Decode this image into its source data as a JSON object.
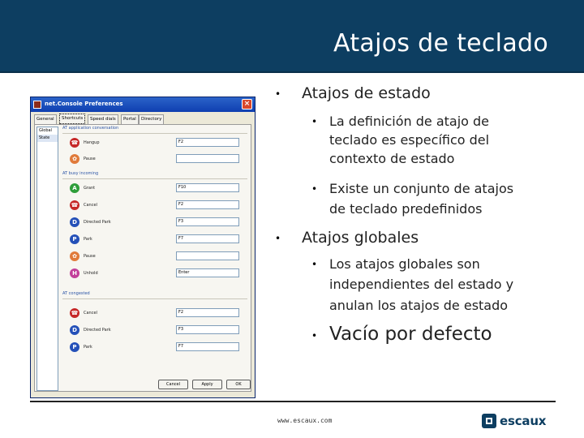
{
  "slide": {
    "title": "Atajos de teclado"
  },
  "screenshot": {
    "window_title": "net.Console Preferences",
    "close_glyph": "×",
    "tabs": [
      "General",
      "Shortcuts",
      "Speed dials",
      "Portal",
      "Directory"
    ],
    "active_tab": "Shortcuts",
    "side_list": [
      "Global",
      "State"
    ],
    "groups": [
      {
        "label": "AT application conversation"
      },
      {
        "label": "AT busy incoming"
      },
      {
        "label": "AT congested"
      }
    ],
    "rows": [
      {
        "label": "Hangup",
        "key": "F2",
        "color": "#c62828",
        "glyph": "☎",
        "icon": "hangup-icon"
      },
      {
        "label": "Pause",
        "key": "",
        "color": "#e07a3a",
        "glyph": "✿",
        "icon": "pause-icon"
      },
      {
        "label": "Grant",
        "key": "F10",
        "color": "#2e9e3a",
        "glyph": "A",
        "icon": "accept-icon"
      },
      {
        "label": "Cancel",
        "key": "F2",
        "color": "#c62828",
        "glyph": "☎",
        "icon": "cancel-icon"
      },
      {
        "label": "Directed Park",
        "key": "F3",
        "color": "#2450b8",
        "glyph": "D",
        "icon": "directed-park-icon"
      },
      {
        "label": "Park",
        "key": "F7",
        "color": "#2450b8",
        "glyph": "P",
        "icon": "park-icon"
      },
      {
        "label": "Pause",
        "key": "",
        "color": "#e07a3a",
        "glyph": "✿",
        "icon": "pause-icon"
      },
      {
        "label": "Unhold",
        "key": "Enter",
        "color": "#c23f9a",
        "glyph": "H",
        "icon": "unhold-icon"
      },
      {
        "label": "Cancel",
        "key": "F2",
        "color": "#c62828",
        "glyph": "☎",
        "icon": "cancel-icon"
      },
      {
        "label": "Directed Park",
        "key": "F3",
        "color": "#2450b8",
        "glyph": "D",
        "icon": "directed-park-icon"
      },
      {
        "label": "Park",
        "key": "F7",
        "color": "#2450b8",
        "glyph": "P",
        "icon": "park-icon"
      }
    ],
    "buttons": [
      "Cancel",
      "Apply",
      "OK"
    ]
  },
  "content": {
    "bullet_glyph": "•",
    "item1": "Atajos de estado",
    "item1_sub1_lines": [
      "La definición de atajo de",
      "teclado es específico del",
      "contexto de estado"
    ],
    "item1_sub2_lines": [
      "Existe un conjunto de atajos",
      "de teclado predefinidos"
    ],
    "item2": "Atajos globales",
    "item2_sub1_lines": [
      "Los atajos globales son",
      "independientes del estado y",
      "anulan los atajos de estado"
    ],
    "item3": "Vacío por defecto"
  },
  "footer": {
    "url": "www.escaux.com",
    "logo_text": "escaux"
  },
  "colors": {
    "header_bg": "#0d3e61",
    "brand": "#0d3e61"
  }
}
